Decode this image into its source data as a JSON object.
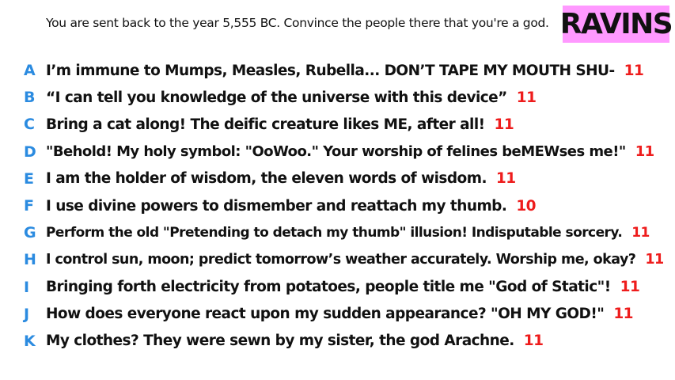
{
  "prompt": "You are sent back to the year 5,555 BC. Convince the people there that you're a god.",
  "badge": "RAVINS",
  "colors": {
    "letter": "#2b8be0",
    "score": "#ee1c1c",
    "badge_bg": "#ff99ff"
  },
  "answers": [
    {
      "letter": "A",
      "text": "I’m immune to Mumps, Measles, Rubella... DON’T TAPE MY MOUTH SHU-",
      "score": "11"
    },
    {
      "letter": "B",
      "text": "“I can tell you knowledge of the universe with this device”",
      "score": "11"
    },
    {
      "letter": "C",
      "text": "Bring a cat along! The deific creature likes ME, after all!",
      "score": "11"
    },
    {
      "letter": "D",
      "text": "\"Behold! My holy symbol: \"OoWoo.\" Your worship of felines beMEWses me!\"",
      "score": "11"
    },
    {
      "letter": "E",
      "text": "I am the holder of wisdom, the eleven words of wisdom.",
      "score": "11"
    },
    {
      "letter": "F",
      "text": "I use divine powers to dismember and reattach my thumb.",
      "score": "10"
    },
    {
      "letter": "G",
      "text": "Perform the old \"Pretending to detach my thumb\" illusion! Indisputable sorcery.",
      "score": "11"
    },
    {
      "letter": "H",
      "text": "I control sun, moon; predict tomorrow’s weather accurately. Worship me, okay?",
      "score": "11"
    },
    {
      "letter": "I",
      "text": "Bringing forth electricity from potatoes, people title me \"God of Static\"!",
      "score": "11"
    },
    {
      "letter": "J",
      "text": "How does everyone react upon my sudden appearance? \"OH MY GOD!\"",
      "score": "11"
    },
    {
      "letter": "K",
      "text": "My clothes? They were sewn by my sister, the god Arachne.",
      "score": "11"
    }
  ]
}
